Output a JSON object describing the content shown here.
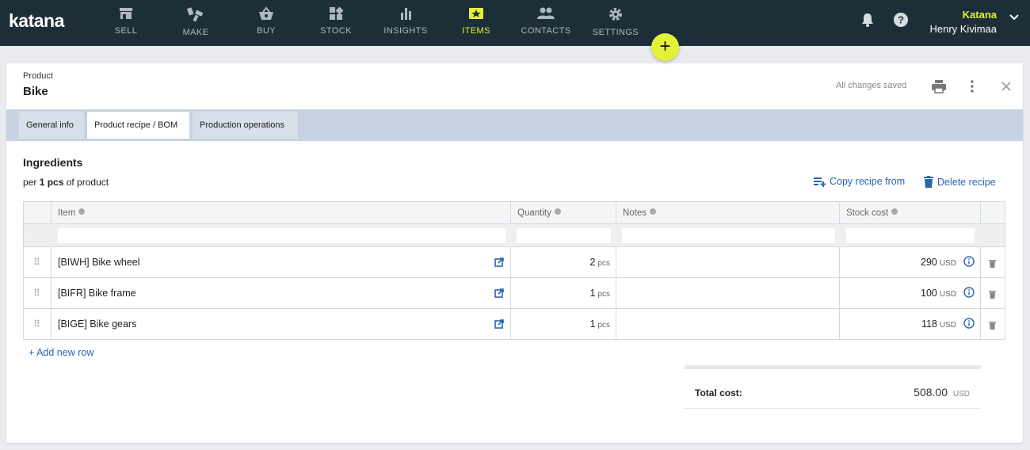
{
  "app": {
    "logo": "katana"
  },
  "nav": [
    {
      "label": "SELL",
      "icon": "shop-icon"
    },
    {
      "label": "MAKE",
      "icon": "tools-icon"
    },
    {
      "label": "BUY",
      "icon": "basket-icon"
    },
    {
      "label": "STOCK",
      "icon": "boxes-icon"
    },
    {
      "label": "INSIGHTS",
      "icon": "bar-chart-icon"
    },
    {
      "label": "ITEMS",
      "icon": "tag-icon",
      "active": true
    },
    {
      "label": "CONTACTS",
      "icon": "people-icon"
    },
    {
      "label": "SETTINGS",
      "icon": "gear-icon"
    }
  ],
  "account": {
    "company": "Katana",
    "user": "Henry Kivimaa"
  },
  "fab": {
    "label": "+"
  },
  "page": {
    "eyebrow": "Product",
    "title": "Bike",
    "save_status": "All changes saved"
  },
  "tabs": [
    {
      "label": "General info"
    },
    {
      "label": "Product recipe / BOM",
      "active": true
    },
    {
      "label": "Production operations"
    }
  ],
  "ingredients": {
    "title": "Ingredients",
    "per_prefix": "per ",
    "per_qty": "1 pcs",
    "per_suffix": " of product",
    "copy_label": "Copy recipe from",
    "delete_label": "Delete recipe",
    "columns": {
      "item": "Item",
      "quantity": "Quantity",
      "notes": "Notes",
      "stock_cost": "Stock cost"
    },
    "rows": [
      {
        "item": "[BIWH] Bike wheel",
        "qty": "2",
        "qty_unit": "pcs",
        "notes": "",
        "cost": "290",
        "cost_unit": "USD"
      },
      {
        "item": "[BIFR] Bike frame",
        "qty": "1",
        "qty_unit": "pcs",
        "notes": "",
        "cost": "100",
        "cost_unit": "USD"
      },
      {
        "item": "[BIGE] Bike gears",
        "qty": "1",
        "qty_unit": "pcs",
        "notes": "",
        "cost": "118",
        "cost_unit": "USD"
      }
    ],
    "add_row_label": "+ Add new row",
    "total_label": "Total cost:",
    "total_value": "508.00",
    "total_unit": "USD"
  },
  "colors": {
    "nav_bg": "#1c2f38",
    "accent": "#e4f237",
    "link": "#2c64b0",
    "tabbar_bg": "#c7d2e2"
  }
}
